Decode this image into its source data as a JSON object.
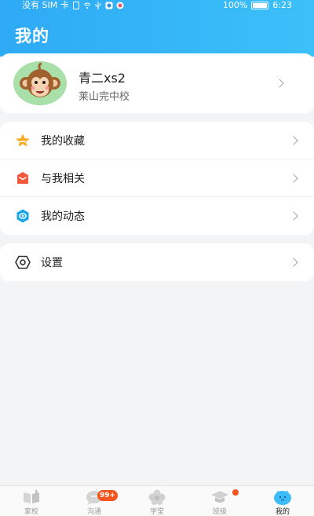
{
  "status_bar": {
    "carrier": "没有 SIM 卡",
    "battery": "100%",
    "time": "6:23"
  },
  "header": {
    "title": "我的"
  },
  "profile": {
    "name": "青二xs2",
    "school": "莱山完中校",
    "avatar_icon": "monkey-avatar-icon"
  },
  "menu": {
    "favorites": {
      "label": "我的收藏",
      "icon": "star-icon",
      "color": "#f7a81b"
    },
    "related": {
      "label": "与我相关",
      "icon": "mail-icon",
      "color": "#f1573b"
    },
    "activity": {
      "label": "我的动态",
      "icon": "hexagon-eye-icon",
      "color": "#19a6e8"
    },
    "settings": {
      "label": "设置",
      "icon": "gear-icon",
      "color": "#333333"
    }
  },
  "tabbar": {
    "tabs": [
      {
        "label": "家校",
        "icon": "book-icon"
      },
      {
        "label": "沟通",
        "icon": "chat-icon"
      },
      {
        "label": "学堂",
        "icon": "flower-icon"
      },
      {
        "label": "班级",
        "icon": "graduation-cap-icon"
      },
      {
        "label": "我的",
        "icon": "smile-face-icon"
      }
    ],
    "chat_badge": "99+",
    "active_color": "#3cbcf8"
  }
}
